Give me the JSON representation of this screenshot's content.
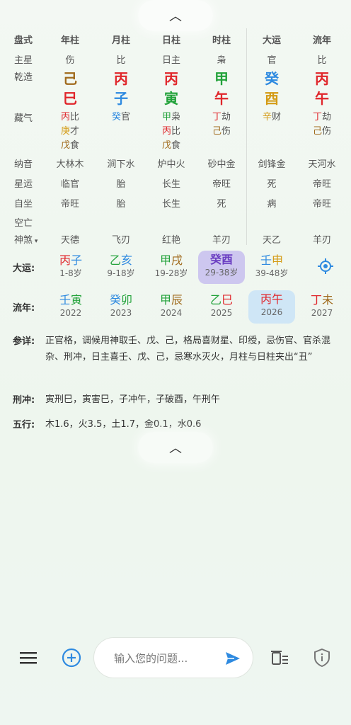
{
  "header_labels": {
    "pan": "盘式",
    "year": "年柱",
    "month": "月柱",
    "day": "日柱",
    "hour": "时柱",
    "dayun": "大运",
    "liunian": "流年"
  },
  "row_labels": {
    "zhuxing": "主星",
    "qianzao": "乾造",
    "canggan": "藏气",
    "nayin": "纳音",
    "xingyun": "星运",
    "zizuo": "自坐",
    "kongwang": "空亡",
    "shensha": "神煞"
  },
  "zhuxing": [
    "伤",
    "比",
    "日主",
    "枭",
    "官",
    "比"
  ],
  "tiangan": [
    "己",
    "丙",
    "丙",
    "甲",
    "癸",
    "丙"
  ],
  "dizhi": [
    "巳",
    "子",
    "寅",
    "午",
    "酉",
    "午"
  ],
  "canggan": [
    [
      {
        "gan": "丙",
        "shen": "比"
      },
      {
        "gan": "庚",
        "shen": "才"
      },
      {
        "gan": "戊",
        "shen": "食"
      }
    ],
    [
      {
        "gan": "癸",
        "shen": "官"
      }
    ],
    [
      {
        "gan": "甲",
        "shen": "枭"
      },
      {
        "gan": "丙",
        "shen": "比"
      },
      {
        "gan": "戊",
        "shen": "食"
      }
    ],
    [
      {
        "gan": "丁",
        "shen": "劫"
      },
      {
        "gan": "己",
        "shen": "伤"
      }
    ],
    [
      {
        "gan": "辛",
        "shen": "财"
      }
    ],
    [
      {
        "gan": "丁",
        "shen": "劫"
      },
      {
        "gan": "己",
        "shen": "伤"
      }
    ]
  ],
  "nayin": [
    "大林木",
    "涧下水",
    "炉中火",
    "砂中金",
    "剑锋金",
    "天河水"
  ],
  "xingyun": [
    "临官",
    "胎",
    "长生",
    "帝旺",
    "死",
    "帝旺"
  ],
  "zizuo": [
    "帝旺",
    "胎",
    "长生",
    "死",
    "病",
    "帝旺"
  ],
  "shensha": [
    "天德",
    "飞刃",
    "红艳",
    "羊刃",
    "天乙",
    "羊刃"
  ],
  "dayun": {
    "label": "大运:",
    "items": [
      {
        "g": "丙",
        "z": "子",
        "age": "1-8岁"
      },
      {
        "g": "乙",
        "z": "亥",
        "age": "9-18岁"
      },
      {
        "g": "甲",
        "z": "戌",
        "age": "19-28岁"
      },
      {
        "g": "癸",
        "z": "酉",
        "age": "29-38岁"
      },
      {
        "g": "壬",
        "z": "申",
        "age": "39-48岁"
      }
    ]
  },
  "liunian": {
    "label": "流年:",
    "items": [
      {
        "g": "壬",
        "z": "寅",
        "year": "2022"
      },
      {
        "g": "癸",
        "z": "卯",
        "year": "2023"
      },
      {
        "g": "甲",
        "z": "辰",
        "year": "2024"
      },
      {
        "g": "乙",
        "z": "巳",
        "year": "2025"
      },
      {
        "g": "丙",
        "z": "午",
        "year": "2026"
      },
      {
        "g": "丁",
        "z": "未",
        "year": "2027"
      }
    ]
  },
  "canxiang": {
    "label": "参详:",
    "text": "正官格，调候用神取壬、戊、己，格局喜财星、印绶，忌伤官、官杀混杂、刑冲，日主喜壬、戊、己，忌寒水灭火，月柱与日柱夹出“丑”"
  },
  "xingchong": {
    "label": "刑冲:",
    "text": "寅刑巳，寅害巳，子冲午，子破酉，午刑午"
  },
  "wuxing": {
    "label": "五行:",
    "text": "木1.6，火3.5，土1.7，金0.1，水0.6"
  },
  "input": {
    "placeholder": "输入您的问题..."
  },
  "colors": {
    "wood": "#22a23a",
    "fire": "#e0262b",
    "water": "#2e8ae0",
    "earth": "#a06a1c",
    "metal": "#d49b15"
  }
}
